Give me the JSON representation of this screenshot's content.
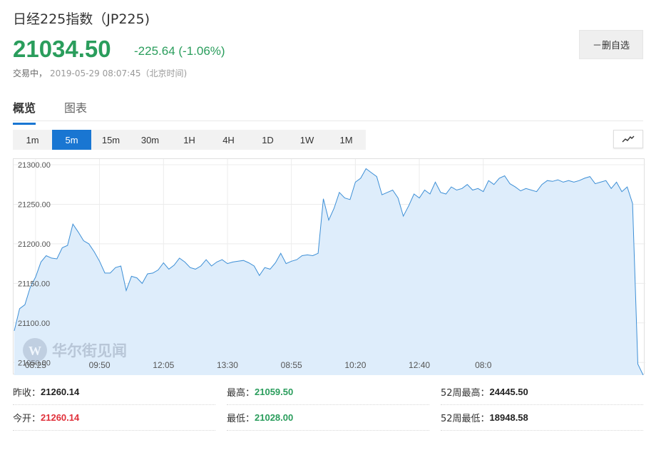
{
  "header": {
    "title": "日经225指数（JP225)",
    "price": "21034.50",
    "change": "-225.64 (-1.06%)",
    "status_label": "交易中，",
    "timestamp": "2019-05-29 08:07:45（北京时间)",
    "remove_watch_label": "－删自选"
  },
  "tabs": [
    {
      "label": "概览",
      "active": true
    },
    {
      "label": "图表",
      "active": false
    }
  ],
  "periods": [
    "1m",
    "5m",
    "15m",
    "30m",
    "1H",
    "4H",
    "1D",
    "1W",
    "1M"
  ],
  "active_period": "5m",
  "watermark": "华尔街见闻",
  "colors": {
    "down": "#2a9d5c",
    "up": "#e0303a",
    "accent": "#1976d2",
    "line": "#3d8fd6",
    "fill": "#deedfb"
  },
  "chart_data": {
    "type": "area",
    "ylim": [
      21034,
      21300
    ],
    "ytick_values": [
      21300,
      21250,
      21200,
      21150,
      21100,
      21050
    ],
    "yticks": [
      "21300.00",
      "21250.00",
      "21200.00",
      "21150.00",
      "21100.00",
      "21050.00"
    ],
    "xtick_positions": [
      4,
      16,
      28,
      40,
      52,
      64,
      76,
      88
    ],
    "xticks": [
      "08:25",
      "09:50",
      "12:05",
      "13:30",
      "08:55",
      "10:20",
      "12:40",
      "08:0"
    ],
    "grid": true,
    "values": [
      21090,
      21118,
      21123,
      21145,
      21158,
      21177,
      21185,
      21182,
      21181,
      21195,
      21198,
      21225,
      21215,
      21204,
      21200,
      21190,
      21178,
      21163,
      21163,
      21170,
      21172,
      21141,
      21159,
      21157,
      21150,
      21162,
      21163,
      21167,
      21176,
      21168,
      21173,
      21182,
      21177,
      21170,
      21168,
      21172,
      21180,
      21172,
      21177,
      21180,
      21175,
      21177,
      21178,
      21179,
      21176,
      21172,
      21160,
      21170,
      21168,
      21176,
      21188,
      21175,
      21178,
      21180,
      21185,
      21186,
      21185,
      21188,
      21257,
      21230,
      21245,
      21265,
      21258,
      21256,
      21278,
      21283,
      21295,
      21290,
      21285,
      21262,
      21265,
      21268,
      21258,
      21235,
      21248,
      21263,
      21258,
      21268,
      21263,
      21278,
      21265,
      21263,
      21272,
      21268,
      21270,
      21275,
      21268,
      21270,
      21266,
      21280,
      21275,
      21283,
      21286,
      21276,
      21272,
      21267,
      21270,
      21268,
      21266,
      21275,
      21280,
      21279,
      21281,
      21278,
      21280,
      21278,
      21280,
      21283,
      21285,
      21276,
      21278,
      21280,
      21270,
      21278,
      21266,
      21272,
      21251,
      21048,
      21034
    ]
  },
  "stats": [
    {
      "label": "昨收：",
      "value": "21260.14",
      "color": "dark"
    },
    {
      "label": "最高：",
      "value": "21059.50",
      "color": "green"
    },
    {
      "label": "52周最高：",
      "value": "24445.50",
      "color": "dark"
    },
    {
      "label": "今开：",
      "value": "21260.14",
      "color": "red"
    },
    {
      "label": "最低：",
      "value": "21028.00",
      "color": "green"
    },
    {
      "label": "52周最低：",
      "value": "18948.58",
      "color": "dark"
    }
  ]
}
